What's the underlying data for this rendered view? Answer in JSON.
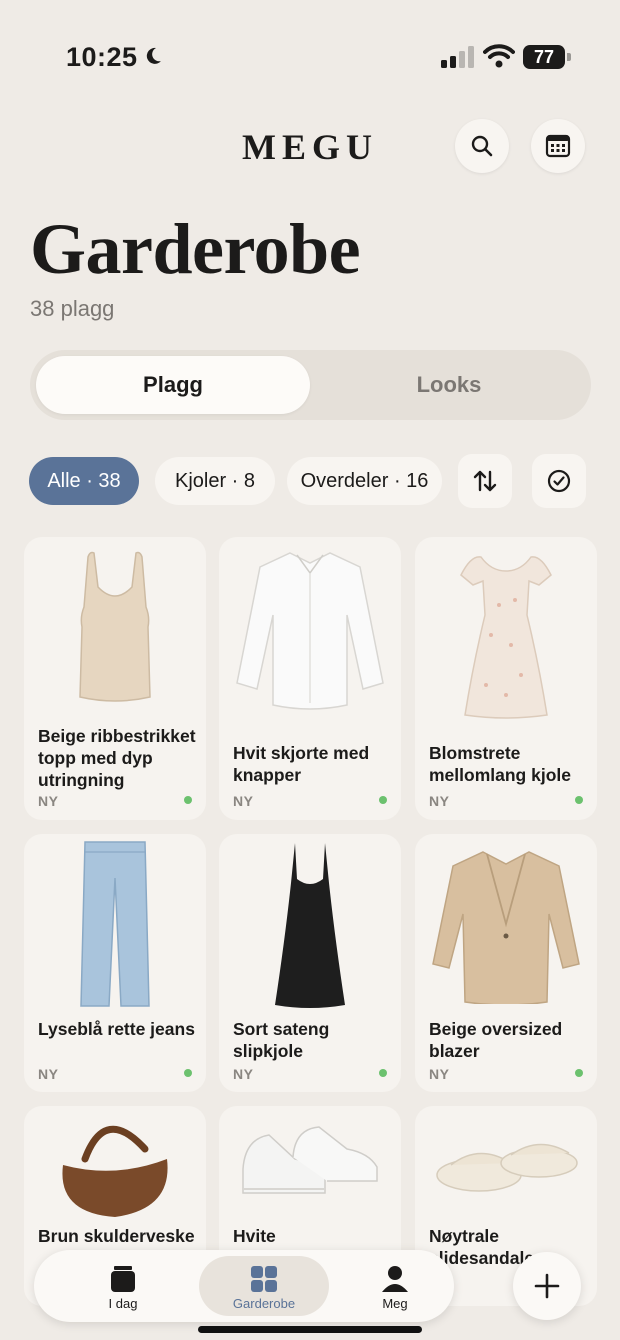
{
  "status_bar": {
    "time": "10:25",
    "battery": "77"
  },
  "header": {
    "brand": "MEGU",
    "title": "Garderobe",
    "subtitle": "38 plagg"
  },
  "segments": {
    "items": "Plagg",
    "looks": "Looks"
  },
  "filters": {
    "all": "Alle · 38",
    "dresses": "Kjoler · 8",
    "tops": "Overdeler · 16"
  },
  "items": [
    {
      "name": "Beige ribbestrikket topp med dyp utringning",
      "tag": "NY",
      "new": true,
      "icon": "tank-top"
    },
    {
      "name": "Hvit skjorte med knapper",
      "tag": "NY",
      "new": true,
      "icon": "shirt"
    },
    {
      "name": "Blomstrete mellomlang kjole",
      "tag": "NY",
      "new": true,
      "icon": "floral-dress"
    },
    {
      "name": "Lyseblå rette jeans",
      "tag": "NY",
      "new": true,
      "icon": "jeans"
    },
    {
      "name": "Sort sateng slipkjole",
      "tag": "NY",
      "new": true,
      "icon": "slip-dress"
    },
    {
      "name": "Beige oversized blazer",
      "tag": "NY",
      "new": true,
      "icon": "blazer"
    },
    {
      "name": "Brun skulderveske",
      "icon": "shoulder-bag"
    },
    {
      "name": "Hvite skinnsneakers",
      "icon": "sneakers"
    },
    {
      "name": "Nøytrale slidesandaler",
      "icon": "slide-sandals"
    }
  ],
  "nav": {
    "today": "I dag",
    "wardrobe": "Garderobe",
    "me": "Meg"
  },
  "colors": {
    "accent": "#5a7398",
    "background": "#efebe6",
    "new_dot": "#6cc16e"
  }
}
